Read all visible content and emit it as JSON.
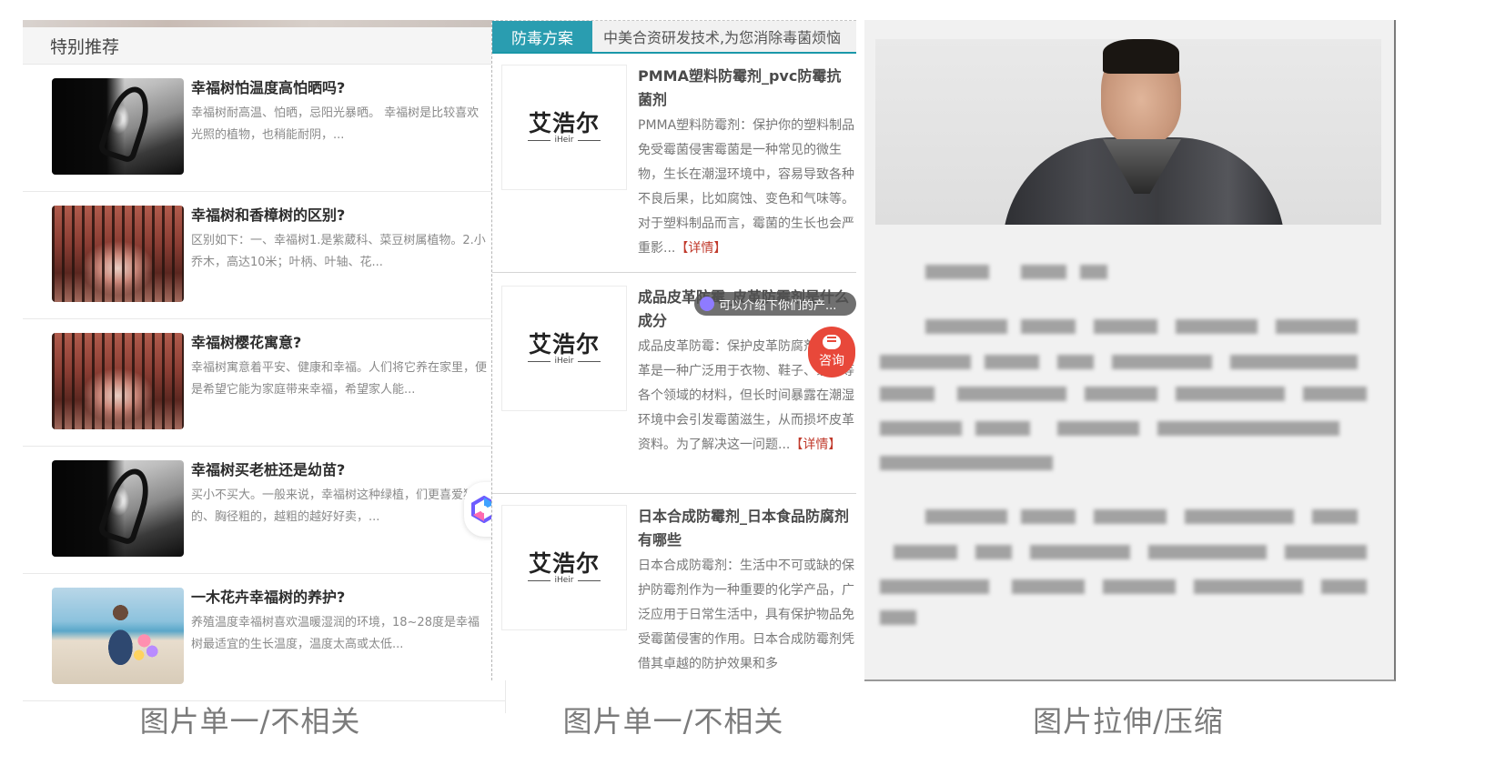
{
  "panel1": {
    "header": "特别推荐",
    "items": [
      {
        "title": "幸福树怕温度高怕晒吗?",
        "desc": "幸福树耐高温、怕晒，忌阳光暴晒。 幸福树是比较喜欢光照的植物，也稍能耐阴，...",
        "thumb": "heart-hands"
      },
      {
        "title": "幸福树和香樟树的区别?",
        "desc": "区别如下：一、幸福树1.是紫葳科、菜豆树属植物。2.小乔木，高达10米；叶柄、叶轴、花...",
        "thumb": "forest-path"
      },
      {
        "title": "幸福树樱花寓意?",
        "desc": "幸福树寓意着平安、健康和幸福。人们将它养在家里，便是希望它能为家庭带来幸福，希望家人能...",
        "thumb": "forest-path"
      },
      {
        "title": "幸福树买老桩还是幼苗?",
        "desc": "买小不买大。一般来说，幸福树这种绿植，们更喜爱独杆的、胸径粗的，越粗的越好好卖，...",
        "thumb": "heart-hands"
      },
      {
        "title": "一木花卉幸福树的养护?",
        "desc": "养殖温度幸福树喜欢温暖湿润的环境，18~28度是幸福树最适宜的生长温度，温度太高或太低...",
        "thumb": "beach-girl"
      }
    ]
  },
  "panel2": {
    "tab_active": "防毒方案",
    "tab_desc": "中美合资研发技术,为您消除毒菌烦恼",
    "logo_cn": "艾浩尔",
    "logo_en": "iHeir",
    "items": [
      {
        "title": "PMMA塑料防霉剂_pvc防霉抗菌剂",
        "desc": "PMMA塑料防霉剂：保护你的塑料制品免受霉菌侵害霉菌是一种常见的微生物，生长在潮湿环境中，容易导致各种不良后果，比如腐蚀、变色和气味等。对于塑料制品而言，霉菌的生长也会严重影...",
        "more": "【详情】"
      },
      {
        "title": "成品皮革防霉_皮革防霉剂是什么成分",
        "desc": "成品皮革防霉：保护皮革防腐剂成品皮革是一种广泛用于衣物、鞋子、家具等各个领域的材料，但长时间暴露在潮湿环境中会引发霉菌滋生，从而损坏皮革资料。为了解决这一问题...",
        "more": "【详情】"
      },
      {
        "title": "日本合成防霉剂_日本食品防腐剂有哪些",
        "desc": "日本合成防霉剂：生活中不可或缺的保护防霉剂作为一种重要的化学产品，广泛应用于日常生活中，具有保护物品免受霉菌侵害的作用。日本合成防霉剂凭借其卓越的防护效果和多",
        "more": ""
      }
    ],
    "chip_text": "可以介绍下你们的产...",
    "consult_label": "咨询"
  },
  "captions": [
    "图片单一/不相关",
    "图片单一/不相关",
    "图片拉伸/压缩"
  ],
  "colors": {
    "tab_active": "#2a9db0",
    "consult": "#e8483a",
    "more_link": "#c0392b"
  }
}
